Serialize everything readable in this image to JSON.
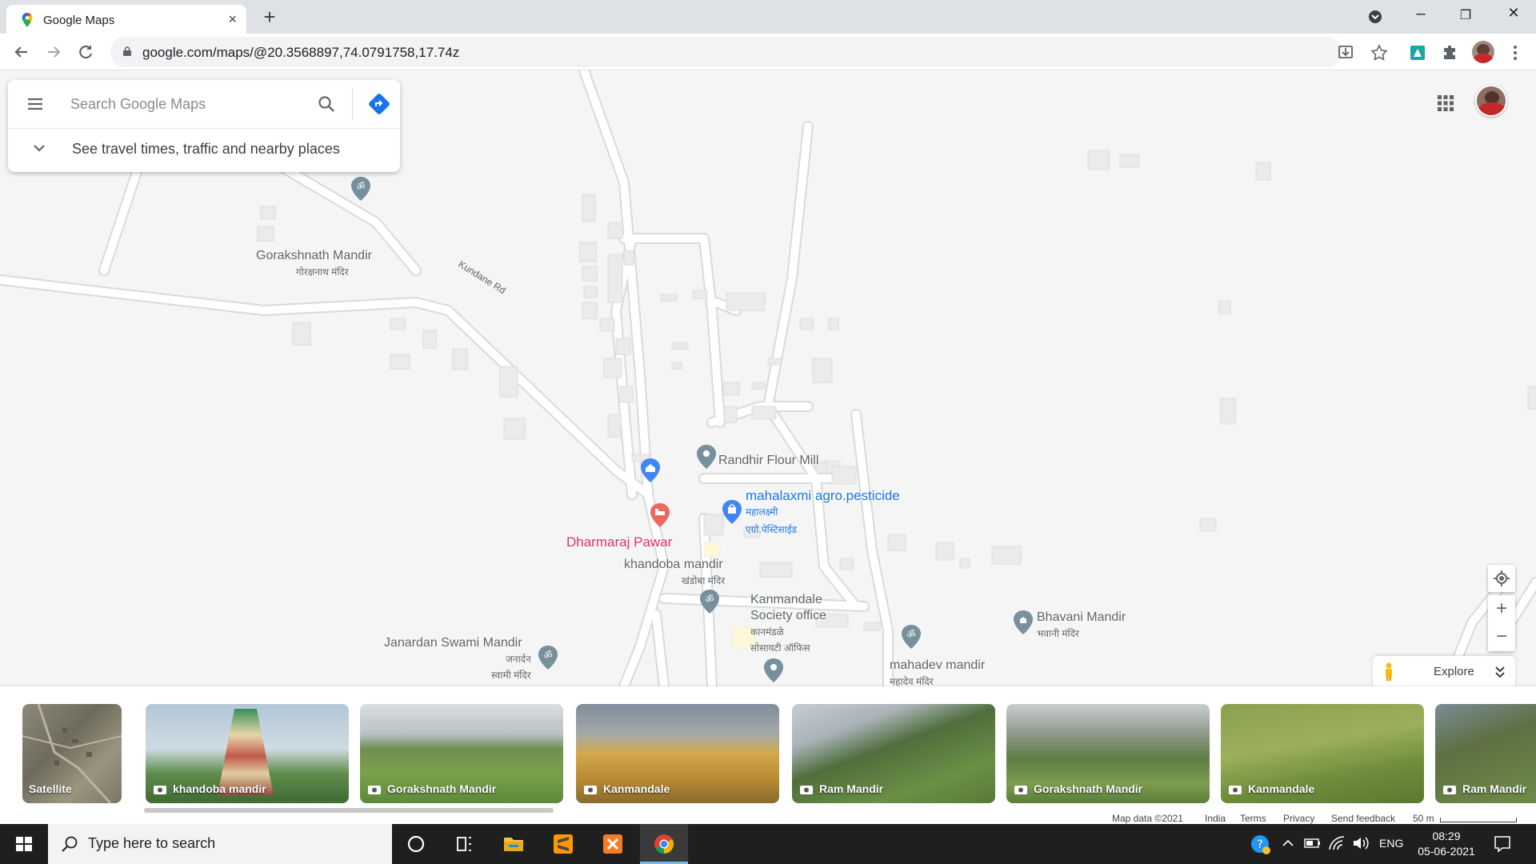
{
  "browser": {
    "tab_title": "Google Maps",
    "tab_close": "×",
    "new_tab": "+",
    "url": "google.com/maps/@20.3568897,74.0791758,17.74z",
    "window_controls": [
      "–",
      "❐",
      "✕"
    ]
  },
  "search": {
    "placeholder": "Search Google Maps",
    "travel_prompt": "See travel times, traffic and nearby places"
  },
  "map": {
    "road_label": "Kundane Rd",
    "places": [
      {
        "name": "Gorakshnath Mandir",
        "sub": "गोरक्षनाथ मंदिर"
      },
      {
        "name": "Randhir Flour Mill"
      },
      {
        "name": "mahalaxmi agro.pesticide",
        "sub1": "महालक्ष्मी",
        "sub2": "एग्रो.पेस्टिसाईड"
      },
      {
        "name": "Dharmaraj Pawar"
      },
      {
        "name": "khandoba mandir",
        "sub": "खंडोबा मंदिर"
      },
      {
        "name": "Kanmandale",
        "name2": "Society office",
        "sub1": "कानमंडळे",
        "sub2": "सोसायटी ऑफिस"
      },
      {
        "name": "Bhavani Mandir",
        "sub": "भवानी मंदिर"
      },
      {
        "name": "Janardan Swami Mandir",
        "sub1": "जनार्दन",
        "sub2": "स्वामी मंदिर"
      },
      {
        "name": "mahadev mandir",
        "sub": "महादेव मंदिर"
      }
    ]
  },
  "controls": {
    "explore": "Explore",
    "zoom_in": "+",
    "zoom_out": "−"
  },
  "photos": [
    {
      "label": "Satellite"
    },
    {
      "label": "khandoba mandir"
    },
    {
      "label": "Gorakshnath Mandir"
    },
    {
      "label": "Kanmandale"
    },
    {
      "label": "Ram Mandir"
    },
    {
      "label": "Gorakshnath Mandir"
    },
    {
      "label": "Kanmandale"
    },
    {
      "label": "Ram Mandir"
    }
  ],
  "footer": {
    "map_data": "Map data ©2021",
    "india": "India",
    "terms": "Terms",
    "privacy": "Privacy",
    "feedback": "Send feedback",
    "scale": "50 m"
  },
  "taskbar": {
    "search_placeholder": "Type here to search",
    "language": "ENG",
    "time": "08:29",
    "date": "05-06-2021"
  }
}
